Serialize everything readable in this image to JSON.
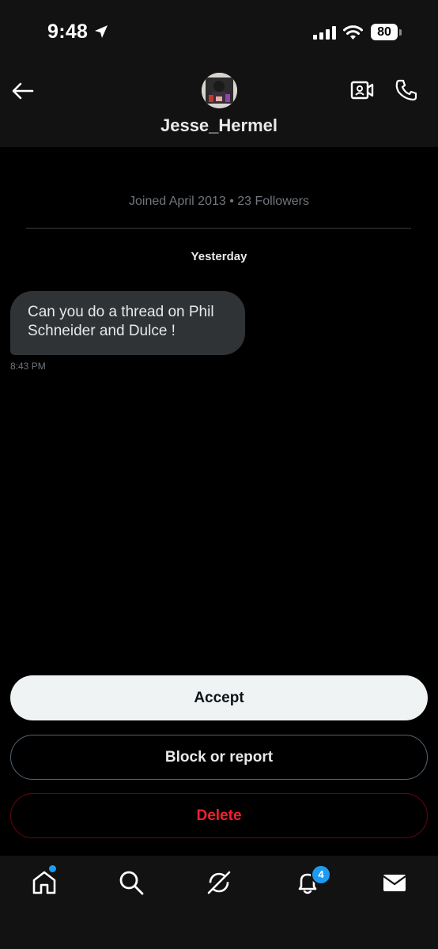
{
  "status_bar": {
    "time": "9:48",
    "battery": "80",
    "icons": [
      "location-arrow-icon",
      "cellular-signal-icon",
      "wifi-icon",
      "battery-icon"
    ]
  },
  "header": {
    "contact_name": "Jesse_Hermel",
    "icons": [
      "back-arrow-icon",
      "video-camera-icon",
      "phone-icon"
    ]
  },
  "conversation": {
    "joined_info": "Joined April 2013 • 23 Followers",
    "date_separator": "Yesterday",
    "messages": [
      {
        "text": "Can you do a thread on Phil Schneider and Dulce !",
        "time": "8:43 PM"
      }
    ]
  },
  "actions": {
    "accept": "Accept",
    "block_or_report": "Block or report",
    "delete": "Delete"
  },
  "bottom_nav": {
    "items": [
      "home-icon",
      "search-icon",
      "grok-icon",
      "notifications-icon",
      "messages-icon"
    ],
    "notification_count": "4"
  },
  "colors": {
    "background": "#000000",
    "header_background": "#121212",
    "bubble": "#2f3336",
    "accent_blue": "#1d9bf0",
    "delete_red": "#f4212e",
    "muted_text": "#71767b"
  }
}
